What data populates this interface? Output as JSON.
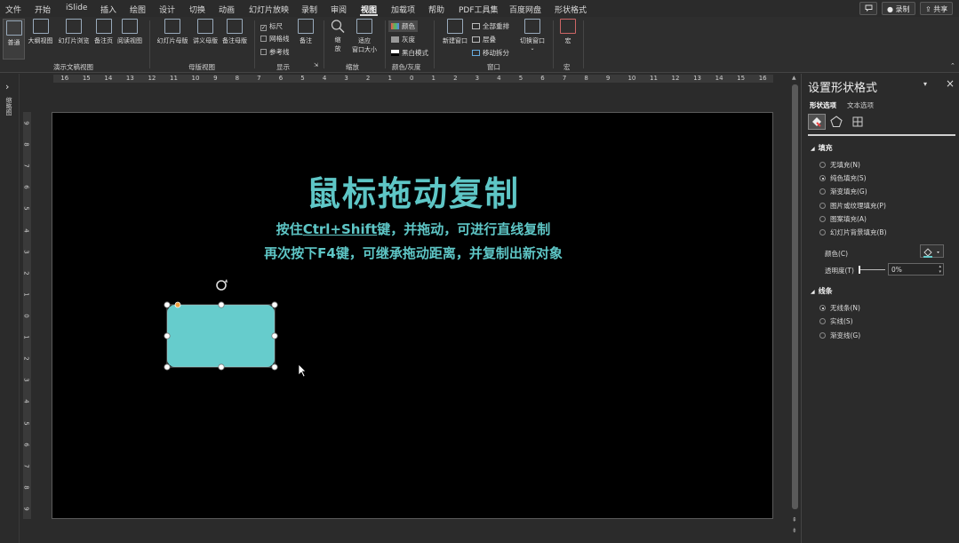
{
  "menu": {
    "items": [
      "文件",
      "开始",
      "iSlide",
      "插入",
      "绘图",
      "设计",
      "切换",
      "动画",
      "幻灯片放映",
      "录制",
      "审阅",
      "视图",
      "加载项",
      "帮助",
      "PDF工具集",
      "百度网盘",
      "形状格式"
    ],
    "active": "视图",
    "right_buttons": {
      "comment_icon": "comment-icon",
      "record": "● 录制",
      "share": "⇪ 共享"
    }
  },
  "ribbon": {
    "buttons": {
      "normal": "普通",
      "outline": "大纲视图",
      "sorter": "幻灯片浏览",
      "notes_page": "备注页",
      "reading": "阅读视图",
      "slide_master": "幻灯片母版",
      "handout_master": "讲义母版",
      "notes_master": "备注母版",
      "notes": "备注",
      "zoom_line1": "缩",
      "zoom_line2": "放",
      "fit_line1": "适应",
      "fit_line2": "窗口大小",
      "new_window": "新建窗口",
      "switch_window": "切换窗口",
      "macro": "宏"
    },
    "checkboxes": {
      "ruler": "标尺",
      "gridlines": "网格线",
      "guides": "参考线"
    },
    "ruler_checked": true,
    "color_modes": {
      "color": "颜色",
      "grayscale": "灰度",
      "bw": "黑白模式"
    },
    "window_small": {
      "arrange_all": "全部重排",
      "cascade": "层叠",
      "move_split": "移动拆分"
    },
    "groups": {
      "presentation_views": "演示文稿视图",
      "master_views": "母版视图",
      "show": "显示",
      "zoom": "缩放",
      "color_gray": "颜色/灰度",
      "window": "窗口",
      "macros": "宏"
    }
  },
  "left_strip": {
    "toggle": "›",
    "label": "缩略图"
  },
  "ruler_numbers": {
    "horizontal": [
      "16",
      "15",
      "14",
      "13",
      "12",
      "11",
      "10",
      "9",
      "8",
      "7",
      "6",
      "5",
      "4",
      "3",
      "2",
      "1",
      "0",
      "1",
      "2",
      "3",
      "4",
      "5",
      "6",
      "7",
      "8",
      "9",
      "10",
      "11",
      "12",
      "13",
      "14",
      "15",
      "16"
    ],
    "vertical": [
      "9",
      "8",
      "7",
      "6",
      "5",
      "4",
      "3",
      "2",
      "1",
      "0",
      "1",
      "2",
      "3",
      "4",
      "5",
      "6",
      "7",
      "8",
      "9"
    ]
  },
  "slide": {
    "title": "鼠标拖动复制",
    "line1_a": "按住",
    "line1_link": "Ctrl+Shift",
    "line1_b": "键，并拖动，可进行直线复制",
    "line2": "再次按下F4键，可继承拖动距离，并复制出新对象"
  },
  "panel": {
    "title": "设置形状格式",
    "tab_shape": "形状选项",
    "tab_text": "文本选项",
    "fill_section": "填充",
    "fill_options": [
      "无填充(N)",
      "纯色填充(S)",
      "渐变填充(G)",
      "图片或纹理填充(P)",
      "图案填充(A)",
      "幻灯片背景填充(B)"
    ],
    "fill_selected": "纯色填充(S)",
    "color_label": "颜色(C)",
    "transparency_label": "透明度(T)",
    "transparency_value": "0%",
    "line_section": "线条",
    "line_options": [
      "无线条(N)",
      "实线(S)",
      "渐变线(G)"
    ],
    "line_selected": "无线条(N)"
  },
  "colors": {
    "accent_teal": "#5ec6c6",
    "shape_fill": "#66cccc",
    "slide_bg": "#000000",
    "app_bg": "#2b2b2b"
  }
}
